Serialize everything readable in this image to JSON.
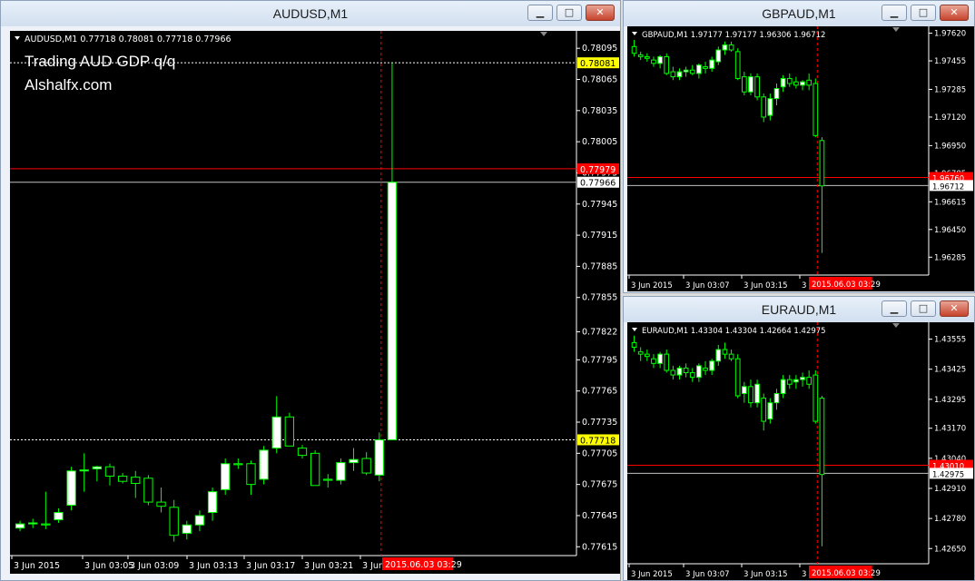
{
  "windows": {
    "audusd": {
      "title": "AUDUSD,M1",
      "info": "AUDUSD,M1  0.77718 0.78081 0.77718 0.77966",
      "overlay_line1": "Trading AUD GDP q/q",
      "overlay_line2": "Alshalfx.com"
    },
    "gbpaud": {
      "title": "GBPAUD,M1",
      "info": "GBPAUD,M1  1.97177 1.97177 1.96306 1.96712"
    },
    "euraud": {
      "title": "EURAUD,M1",
      "info": "EURAUD,M1  1.43304 1.43304 1.42664 1.42975"
    }
  },
  "window_buttons": {
    "minimize": "▁",
    "maximize": "□",
    "close": "✕"
  },
  "colors": {
    "bull": "#ffffff",
    "bear": "#000000",
    "wick": "#00ff00",
    "ask_line": "#ff0000",
    "bid_line": "#c0c0c0",
    "dotted": "#ffffff",
    "vline": "#ff0000",
    "axis": "#ffffff",
    "bid_label_bg": "#ffffff",
    "yellow_label_bg": "#ffff00"
  },
  "chart_data": [
    {
      "type": "candlestick",
      "symbol": "AUDUSD,M1",
      "ylim": [
        0.7761,
        0.7811
      ],
      "yticks": [
        "0.78095",
        "0.78065",
        "0.78035",
        "0.78005",
        "0.77975",
        "0.77945",
        "0.77915",
        "0.77885",
        "0.77855",
        "0.77822",
        "0.77795",
        "0.77765",
        "0.77735",
        "0.77705",
        "0.77675",
        "0.77645",
        "0.77615"
      ],
      "ytick_values": [
        0.78095,
        0.78065,
        0.78035,
        0.78005,
        0.77975,
        0.77945,
        0.77915,
        0.77885,
        0.77855,
        0.77822,
        0.77795,
        0.77765,
        0.77735,
        0.77705,
        0.77675,
        0.77645,
        0.77615
      ],
      "xlabels": [
        "3 Jun 2015",
        "3 Jun 03:05",
        "3 Jun 03:09",
        "3 Jun 03:13",
        "3 Jun 03:17",
        "3 Jun 03:21",
        "3 Jun"
      ],
      "time_highlight": "2015.06.03 03:29",
      "bid": 0.77966,
      "bid_label": "0.77966",
      "ask": 0.77979,
      "ask_label": "0.77979",
      "hline_high": 0.78081,
      "hline_high_label": "0.78081",
      "hline_low": 0.77718,
      "hline_low_label": "0.77718",
      "candles": [
        {
          "o": 0.77633,
          "h": 0.7764,
          "l": 0.7763,
          "c": 0.77637
        },
        {
          "o": 0.77637,
          "h": 0.77642,
          "l": 0.77633,
          "c": 0.77638
        },
        {
          "o": 0.77637,
          "h": 0.77668,
          "l": 0.77632,
          "c": 0.77636
        },
        {
          "o": 0.77641,
          "h": 0.77652,
          "l": 0.77638,
          "c": 0.77648
        },
        {
          "o": 0.77655,
          "h": 0.77692,
          "l": 0.7765,
          "c": 0.77688
        },
        {
          "o": 0.77688,
          "h": 0.77705,
          "l": 0.77668,
          "c": 0.77689
        },
        {
          "o": 0.7769,
          "h": 0.77693,
          "l": 0.77678,
          "c": 0.77692
        },
        {
          "o": 0.77692,
          "h": 0.77695,
          "l": 0.77674,
          "c": 0.77683
        },
        {
          "o": 0.77683,
          "h": 0.77686,
          "l": 0.77676,
          "c": 0.77678
        },
        {
          "o": 0.77682,
          "h": 0.77688,
          "l": 0.77662,
          "c": 0.77676
        },
        {
          "o": 0.77681,
          "h": 0.77684,
          "l": 0.77655,
          "c": 0.77658
        },
        {
          "o": 0.77658,
          "h": 0.77672,
          "l": 0.77648,
          "c": 0.77654
        },
        {
          "o": 0.77653,
          "h": 0.7766,
          "l": 0.7762,
          "c": 0.77626
        },
        {
          "o": 0.77628,
          "h": 0.7764,
          "l": 0.77622,
          "c": 0.77636
        },
        {
          "o": 0.77636,
          "h": 0.7765,
          "l": 0.7763,
          "c": 0.77645
        },
        {
          "o": 0.77648,
          "h": 0.77672,
          "l": 0.7764,
          "c": 0.77668
        },
        {
          "o": 0.7767,
          "h": 0.777,
          "l": 0.77665,
          "c": 0.77695
        },
        {
          "o": 0.77695,
          "h": 0.777,
          "l": 0.7769,
          "c": 0.77694
        },
        {
          "o": 0.77695,
          "h": 0.77698,
          "l": 0.77665,
          "c": 0.77675
        },
        {
          "o": 0.7768,
          "h": 0.77712,
          "l": 0.77675,
          "c": 0.77708
        },
        {
          "o": 0.7771,
          "h": 0.7776,
          "l": 0.77705,
          "c": 0.7774
        },
        {
          "o": 0.7774,
          "h": 0.77744,
          "l": 0.77712,
          "c": 0.77712
        },
        {
          "o": 0.7771,
          "h": 0.77713,
          "l": 0.777,
          "c": 0.77703
        },
        {
          "o": 0.77705,
          "h": 0.77708,
          "l": 0.77674,
          "c": 0.77674
        },
        {
          "o": 0.7768,
          "h": 0.77685,
          "l": 0.77672,
          "c": 0.77679
        },
        {
          "o": 0.77679,
          "h": 0.777,
          "l": 0.77675,
          "c": 0.77696
        },
        {
          "o": 0.77696,
          "h": 0.7771,
          "l": 0.77688,
          "c": 0.77699
        },
        {
          "o": 0.777,
          "h": 0.77706,
          "l": 0.77684,
          "c": 0.77686
        },
        {
          "o": 0.77684,
          "h": 0.77725,
          "l": 0.77678,
          "c": 0.77718
        },
        {
          "o": 0.77718,
          "h": 0.78081,
          "l": 0.77718,
          "c": 0.77966
        }
      ]
    },
    {
      "type": "candlestick",
      "symbol": "GBPAUD,M1",
      "ylim": [
        1.962,
        1.9765
      ],
      "yticks": [
        "1.97620",
        "1.97455",
        "1.97285",
        "1.97120",
        "1.96950",
        "1.96785",
        "1.96615",
        "1.96450",
        "1.96285"
      ],
      "ytick_values": [
        1.9762,
        1.97455,
        1.97285,
        1.9712,
        1.9695,
        1.96785,
        1.96615,
        1.9645,
        1.96285
      ],
      "xlabels": [
        "3 Jun 2015",
        "3 Jun 03:07",
        "3 Jun 03:15",
        "3"
      ],
      "time_highlight": "2015.06.03 03:29",
      "bid": 1.96712,
      "bid_label": "1.96712",
      "ask": 1.9676,
      "ask_label": "1.96760",
      "candles": [
        {
          "o": 1.9754,
          "h": 1.9758,
          "l": 1.9748,
          "c": 1.975
        },
        {
          "o": 1.9749,
          "h": 1.9751,
          "l": 1.9746,
          "c": 1.9748
        },
        {
          "o": 1.9748,
          "h": 1.975,
          "l": 1.9745,
          "c": 1.9747
        },
        {
          "o": 1.9746,
          "h": 1.9748,
          "l": 1.9742,
          "c": 1.9744
        },
        {
          "o": 1.9744,
          "h": 1.9749,
          "l": 1.9741,
          "c": 1.9748
        },
        {
          "o": 1.9748,
          "h": 1.975,
          "l": 1.9737,
          "c": 1.9738
        },
        {
          "o": 1.9739,
          "h": 1.9742,
          "l": 1.9734,
          "c": 1.9736
        },
        {
          "o": 1.9736,
          "h": 1.9741,
          "l": 1.9734,
          "c": 1.9739
        },
        {
          "o": 1.9739,
          "h": 1.9742,
          "l": 1.9736,
          "c": 1.974
        },
        {
          "o": 1.974,
          "h": 1.9743,
          "l": 1.9737,
          "c": 1.9738
        },
        {
          "o": 1.9738,
          "h": 1.9744,
          "l": 1.9735,
          "c": 1.9743
        },
        {
          "o": 1.9742,
          "h": 1.9745,
          "l": 1.9738,
          "c": 1.9741
        },
        {
          "o": 1.9741,
          "h": 1.9748,
          "l": 1.9739,
          "c": 1.9746
        },
        {
          "o": 1.9745,
          "h": 1.9754,
          "l": 1.9743,
          "c": 1.9752
        },
        {
          "o": 1.9752,
          "h": 1.9757,
          "l": 1.9749,
          "c": 1.9755
        },
        {
          "o": 1.9755,
          "h": 1.9757,
          "l": 1.9751,
          "c": 1.9752
        },
        {
          "o": 1.9751,
          "h": 1.9753,
          "l": 1.9734,
          "c": 1.9735
        },
        {
          "o": 1.9736,
          "h": 1.9739,
          "l": 1.9725,
          "c": 1.9727
        },
        {
          "o": 1.9727,
          "h": 1.9738,
          "l": 1.9725,
          "c": 1.9736
        },
        {
          "o": 1.9736,
          "h": 1.9738,
          "l": 1.9722,
          "c": 1.9724
        },
        {
          "o": 1.9724,
          "h": 1.9726,
          "l": 1.9709,
          "c": 1.9712
        },
        {
          "o": 1.9713,
          "h": 1.9726,
          "l": 1.971,
          "c": 1.9723
        },
        {
          "o": 1.9723,
          "h": 1.9732,
          "l": 1.9719,
          "c": 1.9729
        },
        {
          "o": 1.973,
          "h": 1.9737,
          "l": 1.9727,
          "c": 1.9735
        },
        {
          "o": 1.9735,
          "h": 1.9738,
          "l": 1.973,
          "c": 1.9732
        },
        {
          "o": 1.9733,
          "h": 1.9736,
          "l": 1.9729,
          "c": 1.9731
        },
        {
          "o": 1.9731,
          "h": 1.9734,
          "l": 1.9728,
          "c": 1.9733
        },
        {
          "o": 1.9734,
          "h": 1.9738,
          "l": 1.9728,
          "c": 1.9731
        },
        {
          "o": 1.9732,
          "h": 1.9735,
          "l": 1.97,
          "c": 1.9701
        },
        {
          "o": 1.9698,
          "h": 1.97,
          "l": 1.9631,
          "c": 1.9671
        }
      ]
    },
    {
      "type": "candlestick",
      "symbol": "EURAUD,M1",
      "ylim": [
        1.426,
        1.4362
      ],
      "yticks": [
        "1.43555",
        "1.43425",
        "1.43295",
        "1.43170",
        "1.43040",
        "1.42910",
        "1.42780",
        "1.42650"
      ],
      "ytick_values": [
        1.43555,
        1.43425,
        1.43295,
        1.4317,
        1.4304,
        1.4291,
        1.4278,
        1.4265
      ],
      "xlabels": [
        "3 Jun 2015",
        "3 Jun 03:07",
        "3 Jun 03:15",
        "3"
      ],
      "time_highlight": "2015.06.03 03:29",
      "bid": 1.42975,
      "bid_label": "1.42975",
      "ask": 1.4301,
      "ask_label": "1.43010",
      "candles": [
        {
          "o": 1.4354,
          "h": 1.4357,
          "l": 1.435,
          "c": 1.4352
        },
        {
          "o": 1.435,
          "h": 1.4352,
          "l": 1.4346,
          "c": 1.4349
        },
        {
          "o": 1.4349,
          "h": 1.4351,
          "l": 1.4346,
          "c": 1.4348
        },
        {
          "o": 1.4347,
          "h": 1.4349,
          "l": 1.4343,
          "c": 1.4345
        },
        {
          "o": 1.4345,
          "h": 1.435,
          "l": 1.4343,
          "c": 1.4349
        },
        {
          "o": 1.4349,
          "h": 1.4351,
          "l": 1.4341,
          "c": 1.4342
        },
        {
          "o": 1.4342,
          "h": 1.4344,
          "l": 1.4338,
          "c": 1.434
        },
        {
          "o": 1.434,
          "h": 1.4344,
          "l": 1.4338,
          "c": 1.4343
        },
        {
          "o": 1.4343,
          "h": 1.4345,
          "l": 1.4339,
          "c": 1.4341
        },
        {
          "o": 1.4341,
          "h": 1.4343,
          "l": 1.4337,
          "c": 1.4339
        },
        {
          "o": 1.4339,
          "h": 1.4345,
          "l": 1.4337,
          "c": 1.4344
        },
        {
          "o": 1.4343,
          "h": 1.4346,
          "l": 1.434,
          "c": 1.4342
        },
        {
          "o": 1.4342,
          "h": 1.4347,
          "l": 1.434,
          "c": 1.4346
        },
        {
          "o": 1.4346,
          "h": 1.4353,
          "l": 1.4344,
          "c": 1.4351
        },
        {
          "o": 1.4351,
          "h": 1.4354,
          "l": 1.4347,
          "c": 1.4349
        },
        {
          "o": 1.4349,
          "h": 1.4351,
          "l": 1.4346,
          "c": 1.4347
        },
        {
          "o": 1.4347,
          "h": 1.4349,
          "l": 1.433,
          "c": 1.4331
        },
        {
          "o": 1.4332,
          "h": 1.4337,
          "l": 1.4328,
          "c": 1.4335
        },
        {
          "o": 1.4335,
          "h": 1.4338,
          "l": 1.4326,
          "c": 1.4328
        },
        {
          "o": 1.4328,
          "h": 1.4338,
          "l": 1.4326,
          "c": 1.4336
        },
        {
          "o": 1.433,
          "h": 1.4332,
          "l": 1.4316,
          "c": 1.432
        },
        {
          "o": 1.4321,
          "h": 1.433,
          "l": 1.4319,
          "c": 1.4328
        },
        {
          "o": 1.4328,
          "h": 1.4334,
          "l": 1.4325,
          "c": 1.4332
        },
        {
          "o": 1.4332,
          "h": 1.434,
          "l": 1.433,
          "c": 1.4338
        },
        {
          "o": 1.4338,
          "h": 1.434,
          "l": 1.4334,
          "c": 1.4336
        },
        {
          "o": 1.4337,
          "h": 1.434,
          "l": 1.4334,
          "c": 1.4338
        },
        {
          "o": 1.4338,
          "h": 1.4341,
          "l": 1.4335,
          "c": 1.4339
        },
        {
          "o": 1.4339,
          "h": 1.4342,
          "l": 1.4334,
          "c": 1.4336
        },
        {
          "o": 1.434,
          "h": 1.4342,
          "l": 1.4319,
          "c": 1.432
        },
        {
          "o": 1.433,
          "h": 1.4331,
          "l": 1.4266,
          "c": 1.4297
        }
      ]
    }
  ]
}
